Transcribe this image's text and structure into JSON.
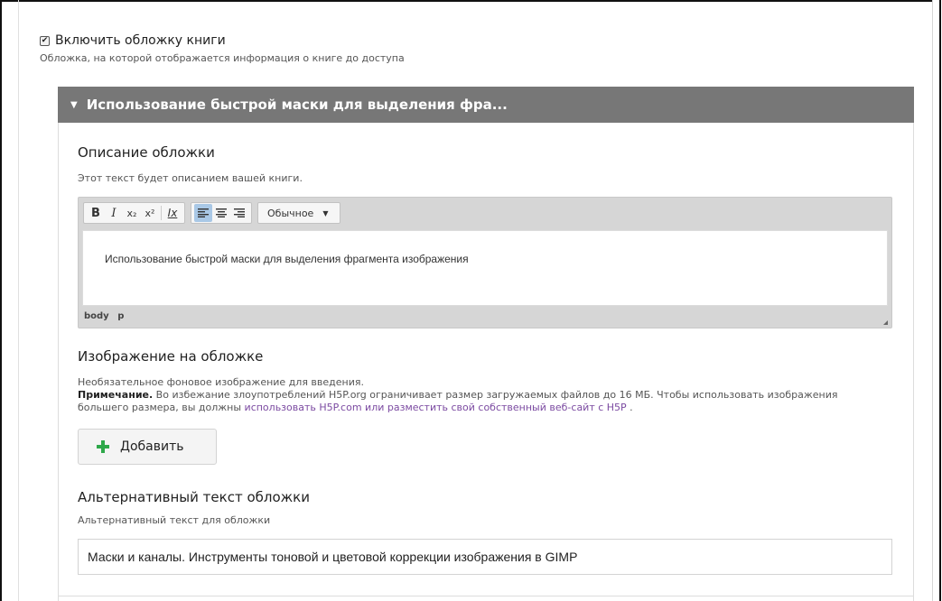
{
  "cover": {
    "checkbox_label": "Включить обложку книги",
    "checked": true,
    "description": "Обложка, на которой отображается информация о книге до доступа"
  },
  "group": {
    "title": "Использование быстрой маски для выделения фра..."
  },
  "cover_description": {
    "label": "Описание обложки",
    "help": "Этот текст будет описанием вашей книги.",
    "editor": {
      "toolbar": {
        "bold": "B",
        "italic": "I",
        "subscript": "x₂",
        "superscript": "x²",
        "clear_format": "Ix",
        "align_left_icon": "align-left-icon",
        "align_center_icon": "align-center-icon",
        "align_right_icon": "align-right-icon",
        "format_select": "Обычное"
      },
      "content": "Использование быстрой маски для выделения фрагмента изображения",
      "path": [
        "body",
        "p"
      ]
    }
  },
  "cover_image": {
    "label": "Изображение на обложке",
    "help": "Необязательное фоновое изображение для введения.",
    "note_bold": "Примечание.",
    "note_text": " Во избежание злоупотреблений H5P.org ограничивает размер загружаемых файлов до 16 МБ. Чтобы использовать изображения большего размера, вы должны ",
    "note_link": "использовать H5P.com или разместить свой собственный веб-сайт с H5P",
    "note_end": " .",
    "add_button": "Добавить"
  },
  "alt_text": {
    "label": "Альтернативный текст обложки",
    "help": "Альтернативный текст для обложки",
    "value": "Маски и каналы. Инструменты тоновой и цветовой коррекции изображения в GIMP"
  },
  "colors": {
    "group_header_bg": "#777777",
    "link": "#7b4aa1",
    "plus_icon": "#2ea84a",
    "active_toolbar": "#a9c8e6"
  }
}
